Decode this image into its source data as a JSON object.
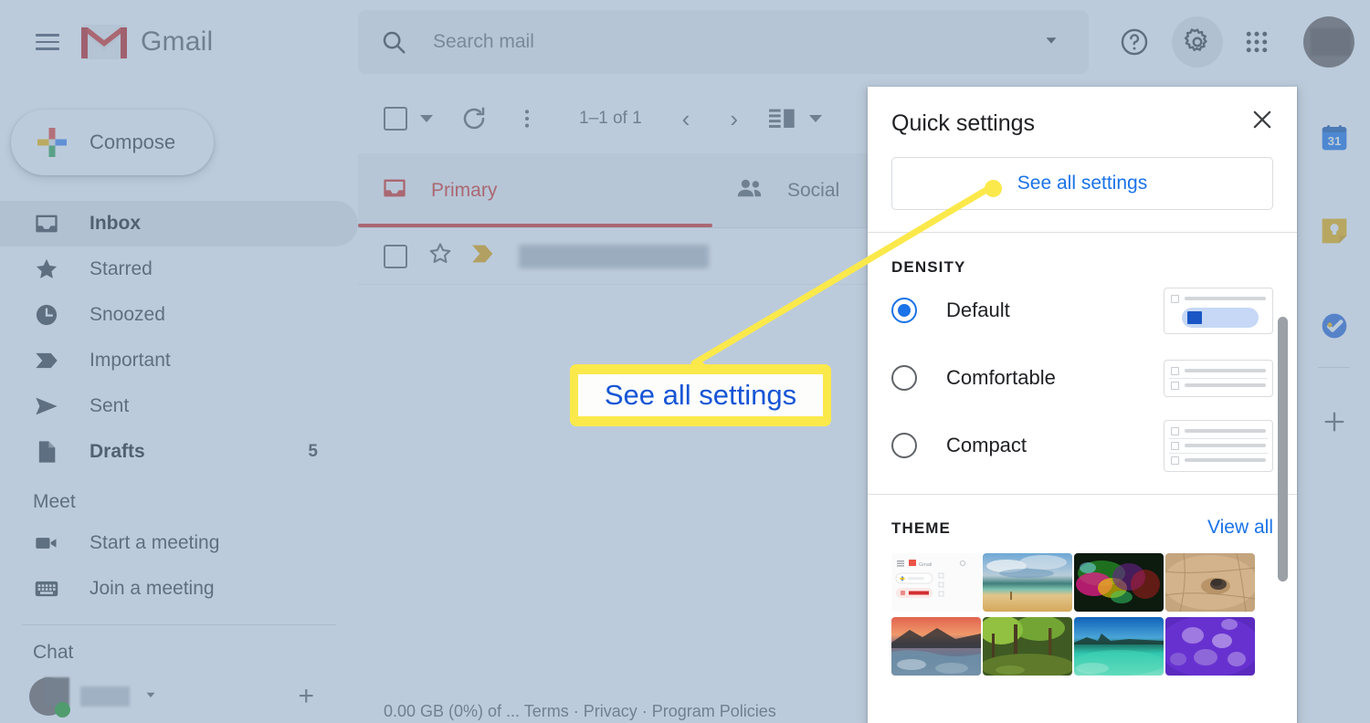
{
  "app": {
    "brand": "Gmail",
    "menu_icon": "hamburger-icon",
    "logo_icon": "gmail-logo-icon"
  },
  "search": {
    "placeholder": "Search mail",
    "value": "",
    "icon": "search-icon",
    "options_icon": "chevron-down-icon"
  },
  "header": {
    "help_icon": "help-circle-icon",
    "settings_icon": "gear-icon",
    "apps_icon": "apps-grid-icon",
    "avatar": "account-avatar"
  },
  "sidebar": {
    "compose_label": "Compose",
    "compose_icon": "plus-icon",
    "items": [
      {
        "label": "Inbox",
        "icon": "inbox-icon",
        "active": true,
        "bold": true,
        "count": ""
      },
      {
        "label": "Starred",
        "icon": "star-icon",
        "active": false,
        "bold": false,
        "count": ""
      },
      {
        "label": "Snoozed",
        "icon": "clock-icon",
        "active": false,
        "bold": false,
        "count": ""
      },
      {
        "label": "Important",
        "icon": "important-icon",
        "active": false,
        "bold": false,
        "count": ""
      },
      {
        "label": "Sent",
        "icon": "send-icon",
        "active": false,
        "bold": false,
        "count": ""
      },
      {
        "label": "Drafts",
        "icon": "draft-icon",
        "active": false,
        "bold": true,
        "count": "5"
      }
    ],
    "meet": {
      "title": "Meet",
      "items": [
        {
          "label": "Start a meeting",
          "icon": "video-camera-icon"
        },
        {
          "label": "Join a meeting",
          "icon": "keyboard-icon"
        }
      ]
    },
    "chat": {
      "title": "Chat",
      "status_icon": "online-status-dot",
      "caret_icon": "chevron-down-icon",
      "add_icon": "plus-icon"
    }
  },
  "toolbar": {
    "select_all_icon": "checkbox-icon",
    "select_caret_icon": "chevron-down-icon",
    "refresh_icon": "refresh-icon",
    "more_icon": "more-vertical-icon",
    "pagination": "1–1 of 1",
    "prev_icon": "chevron-left-icon",
    "next_icon": "chevron-right-icon",
    "split_pane_icon": "split-pane-icon",
    "split_caret_icon": "chevron-down-icon"
  },
  "tabs": [
    {
      "label": "Primary",
      "icon": "inbox-tab-icon",
      "active": true
    },
    {
      "label": "Social",
      "icon": "people-icon",
      "active": false
    }
  ],
  "mail_row": {
    "checkbox_icon": "checkbox-icon",
    "star_icon": "star-outline-icon",
    "important_icon": "important-marker-icon",
    "sender": ""
  },
  "footer": {
    "text": "0.00 GB (0%) of ...  Terms · Privacy · Program Policies"
  },
  "rail": {
    "items": [
      {
        "icon": "google-calendar-icon",
        "label": "31"
      },
      {
        "icon": "google-keep-icon",
        "label": ""
      },
      {
        "icon": "google-tasks-icon",
        "label": ""
      },
      {
        "icon": "add-addon-icon",
        "label": "+"
      }
    ]
  },
  "quick_settings": {
    "title": "Quick settings",
    "close_icon": "close-icon",
    "see_all_label": "See all settings",
    "density": {
      "label": "DENSITY",
      "options": [
        {
          "label": "Default",
          "selected": true
        },
        {
          "label": "Comfortable",
          "selected": false
        },
        {
          "label": "Compact",
          "selected": false
        }
      ]
    },
    "theme": {
      "label": "THEME",
      "view_all_label": "View all",
      "thumbnails": [
        {
          "name": "default-light-theme"
        },
        {
          "name": "beach-theme"
        },
        {
          "name": "neon-lights-theme"
        },
        {
          "name": "desert-stone-theme"
        },
        {
          "name": "sunset-river-theme"
        },
        {
          "name": "green-forest-theme"
        },
        {
          "name": "turquoise-lake-theme"
        },
        {
          "name": "purple-jellyfish-theme"
        }
      ]
    }
  },
  "annotation": {
    "callout_text": "See all settings",
    "callout_color": "#fbe94b",
    "callout_text_color": "#1655d6"
  }
}
